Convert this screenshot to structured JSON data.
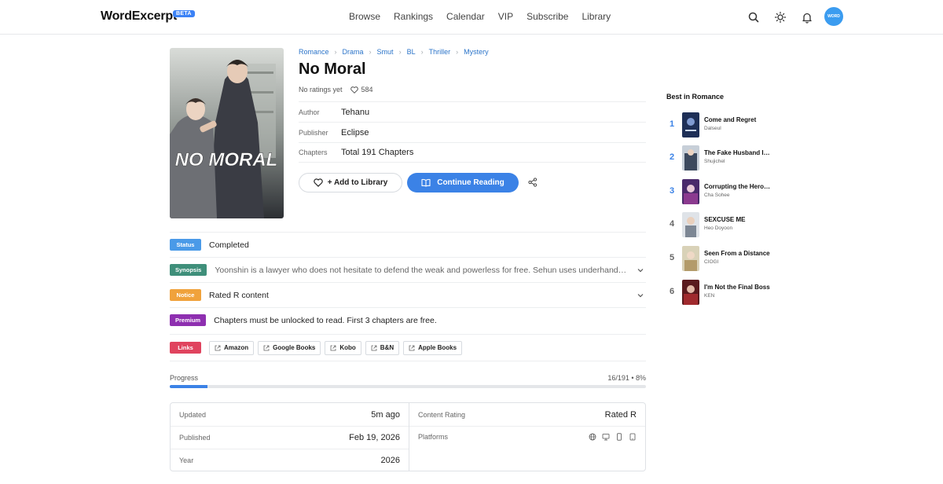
{
  "header": {
    "logo": "WordExcerpt",
    "beta": "BETA",
    "nav": [
      "Browse",
      "Rankings",
      "Calendar",
      "VIP",
      "Subscribe",
      "Library"
    ],
    "avatar_text": "WORD",
    "accent": "#3b82e6"
  },
  "book": {
    "genres": [
      "Romance",
      "Drama",
      "Smut",
      "BL",
      "Thriller",
      "Mystery"
    ],
    "title": "No Moral",
    "cover_text": "NO MORAL",
    "ratings_text": "No ratings yet",
    "likes": "584",
    "author_label": "Author",
    "author": "Tehanu",
    "publisher_label": "Publisher",
    "publisher": "Eclipse",
    "chapters_label": "Chapters",
    "chapters": "Total 191 Chapters",
    "add_library": "+ Add to Library",
    "continue_reading": "Continue Reading"
  },
  "info": {
    "status_badge": "Status",
    "status": "Completed",
    "synopsis_badge": "Synopsis",
    "synopsis": "Yoonshin is a lawyer who does not hesitate to defend the weak and powerless for free. Sehun uses underhanded means to get what he wants.",
    "notice_badge": "Notice",
    "notice": "Rated R content",
    "premium_badge": "Premium",
    "premium": "Chapters must be unlocked to read. First 3 chapters are free.",
    "links_badge": "Links",
    "links": [
      "Amazon",
      "Google Books",
      "Kobo",
      "B&N",
      "Apple Books"
    ],
    "badge_colors": {
      "status": "#4a9ae8",
      "synopsis": "#3f8f7a",
      "notice": "#f0a23c",
      "premium": "#8e2fb0",
      "links": "#e0435e"
    }
  },
  "progress": {
    "label": "Progress",
    "value_text": "16/191 • 8%",
    "fraction": 0.08
  },
  "details": {
    "updated_label": "Updated",
    "updated": "5m ago",
    "published_label": "Published",
    "published": "Feb 19, 2026",
    "year_label": "Year",
    "year": "2026",
    "content_rating_label": "Content Rating",
    "content_rating": "Rated R",
    "platforms_label": "Platforms"
  },
  "sidebar": {
    "title": "Best in Romance",
    "items": [
      {
        "rank": "1",
        "title": "Come and Regret",
        "author": "Dalseul",
        "rank_color": "#3b82e6"
      },
      {
        "rank": "2",
        "title": "The Fake Husband In Law",
        "author": "Shujichel",
        "rank_color": "#3b82e6"
      },
      {
        "rank": "3",
        "title": "Corrupting the Heroine",
        "author": "Cha Sohee",
        "rank_color": "#3b82e6"
      },
      {
        "rank": "4",
        "title": "SEXCUSE ME",
        "author": "Heo Doyoon",
        "rank_color": "#666666"
      },
      {
        "rank": "5",
        "title": "Seen From a Distance",
        "author": "CIOGI",
        "rank_color": "#666666"
      },
      {
        "rank": "6",
        "title": "I'm Not the Final Boss",
        "author": "KEN",
        "rank_color": "#666666"
      }
    ]
  }
}
